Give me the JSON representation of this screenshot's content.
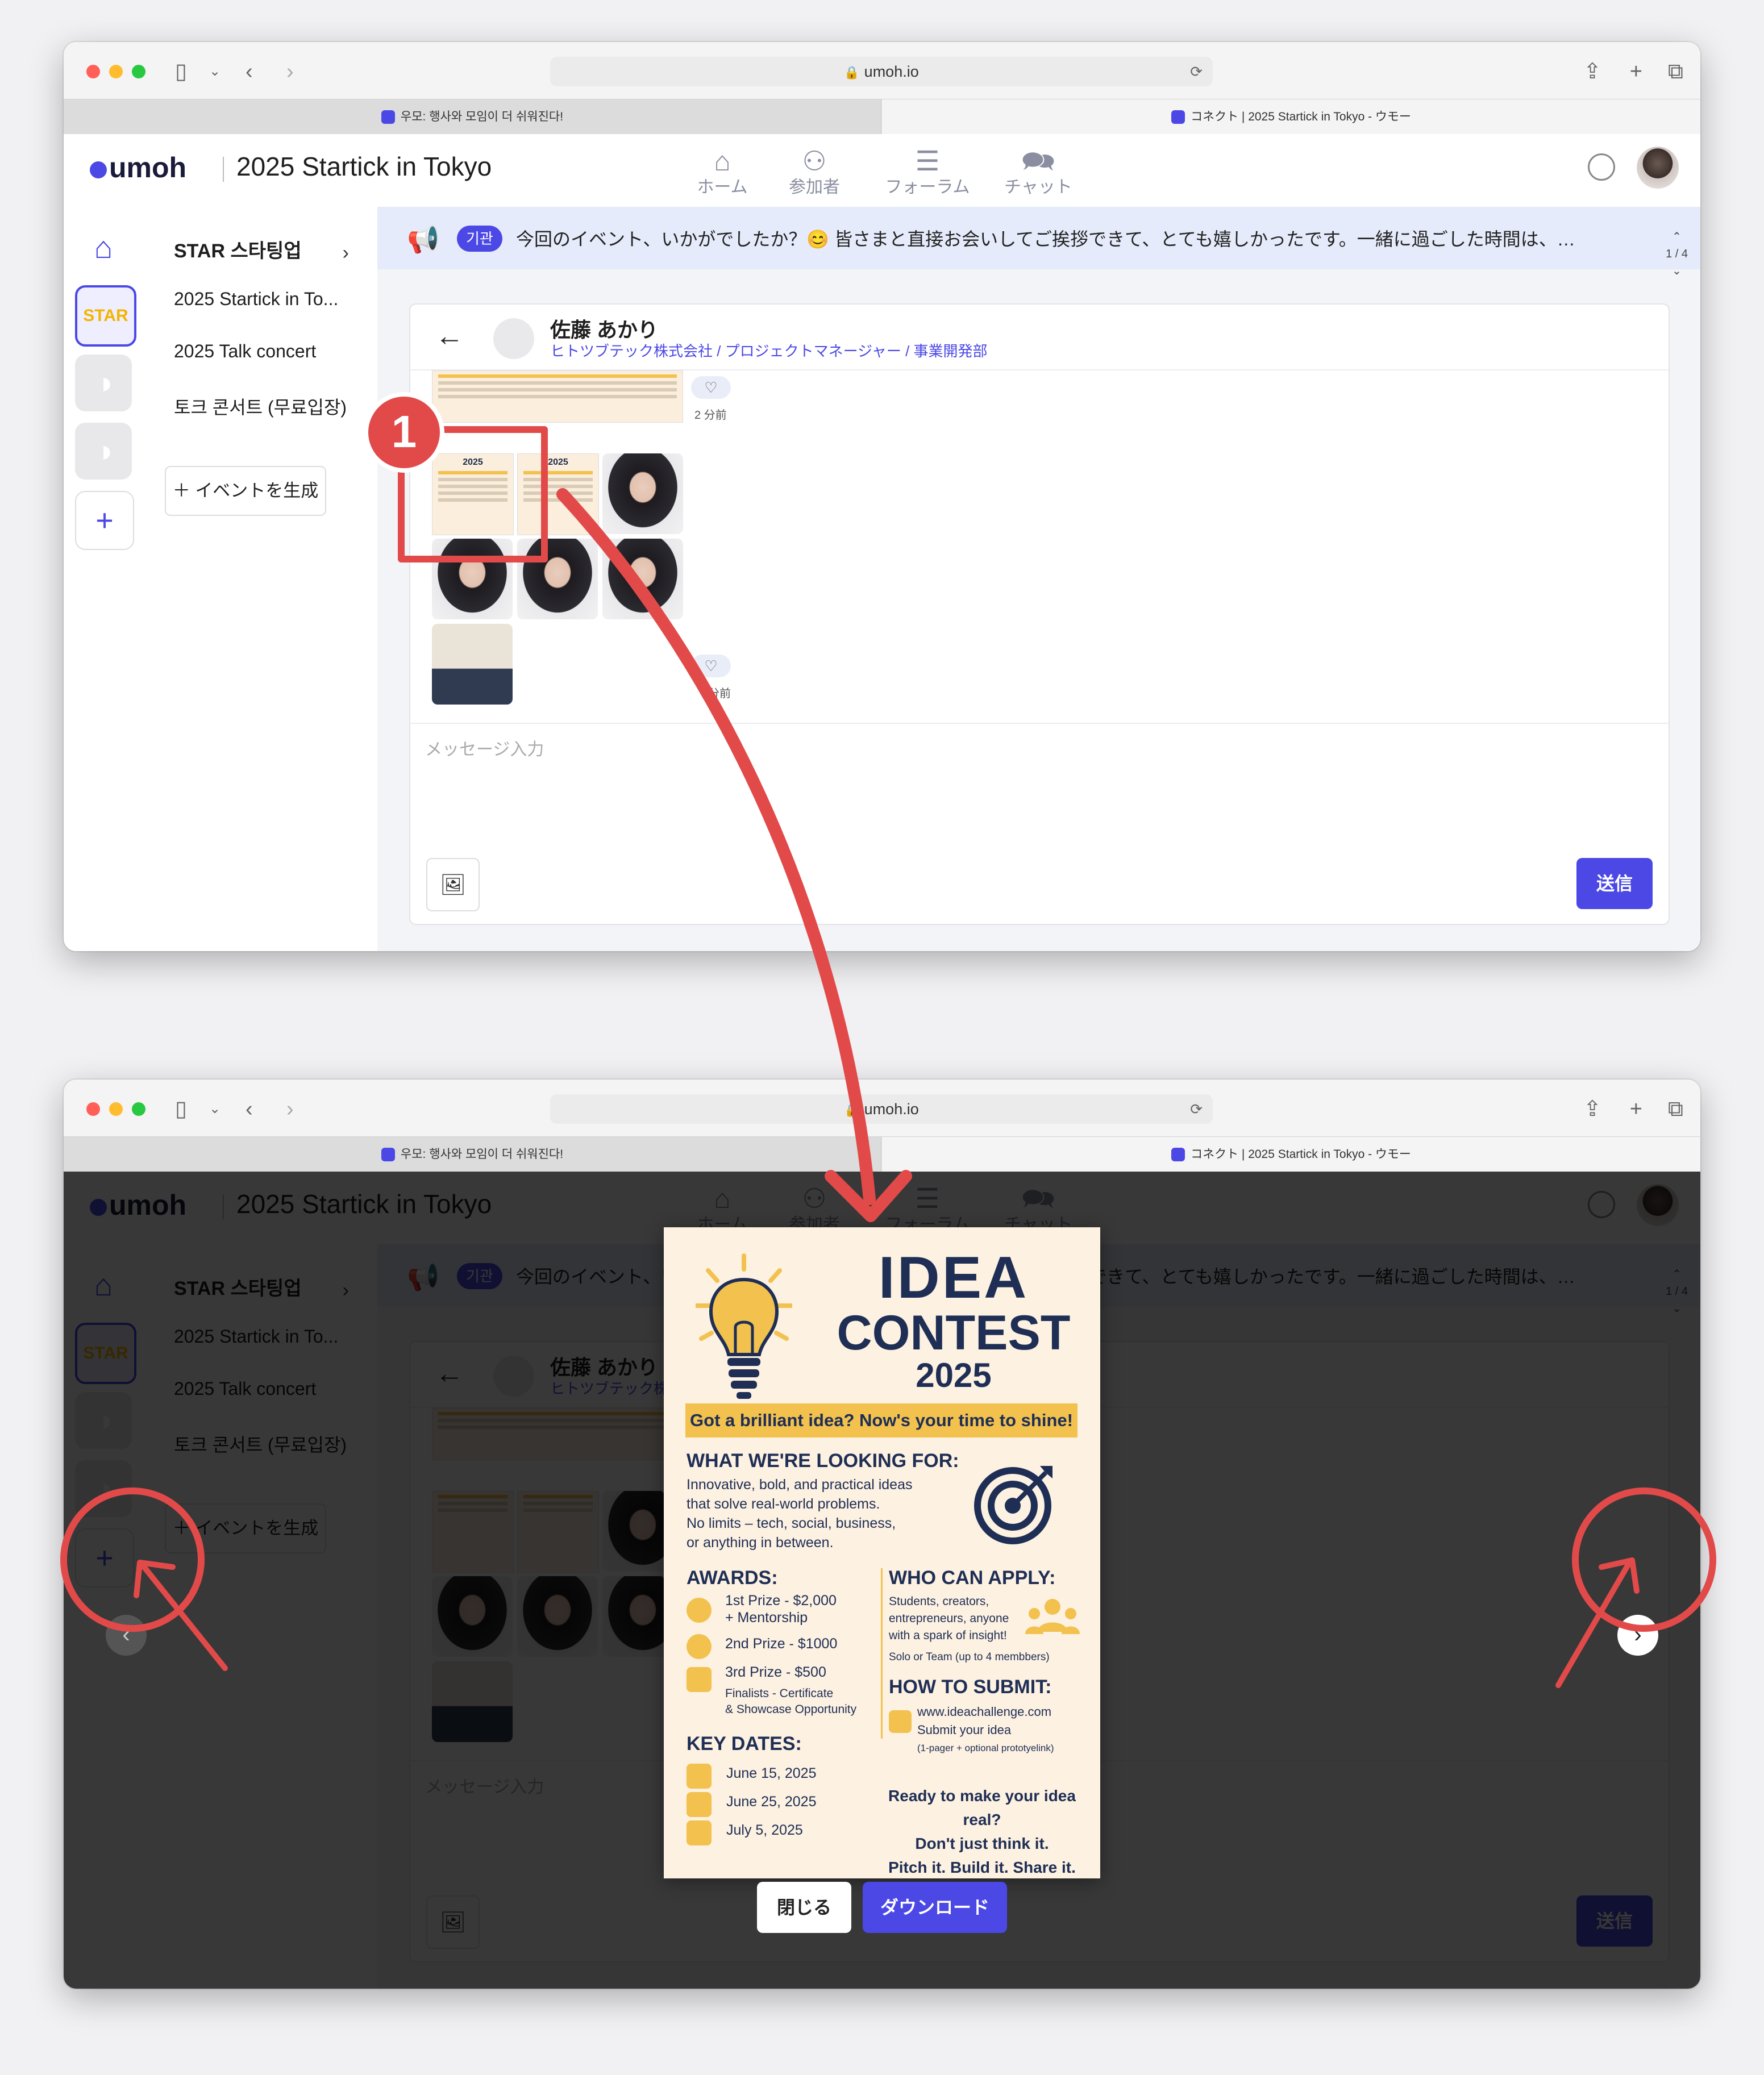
{
  "browser": {
    "url": "umoh.io",
    "tabs": [
      {
        "title": "우모: 행사와 모임이 더 쉬워진다!"
      },
      {
        "title": "コネクト | 2025 Startick in Tokyo - ウモー"
      }
    ]
  },
  "app": {
    "logo": "umoh",
    "event_title": "2025 Startick in Tokyo",
    "nav": [
      {
        "label": "ホーム",
        "icon": "home-icon"
      },
      {
        "label": "参加者",
        "icon": "people-icon"
      },
      {
        "label": "フォーラム",
        "icon": "forum-icon"
      },
      {
        "label": "チャット",
        "icon": "chat-icon"
      }
    ]
  },
  "rail": {
    "star_label": "STAR"
  },
  "sidebar": {
    "org": "STAR 스타팅업",
    "events": [
      "2025 Startick in To...",
      "2025 Talk concert",
      "토크 콘서트 (무료입장)"
    ],
    "create_event": "イベントを生成"
  },
  "notice": {
    "badge": "기관",
    "text": "今回のイベント、いかがでしたか？😊 皆さまと直接お会いしてご挨拶できて、とても嬉しかったです。一緒に過ごした時間は、私たちにとって...",
    "counter": "1 / 4"
  },
  "chat": {
    "partner_name": "佐藤 あかり",
    "partner_org": "ヒトツブテック株式会社 / プロジェクトマネージャー / 事業開発部",
    "time_ago": "2 分前",
    "time_ago_2": "分前",
    "input_placeholder": "メッセージ入力",
    "send_label": "送信"
  },
  "callout": {
    "number": "1"
  },
  "modal": {
    "close_label": "閉じる",
    "download_label": "ダウンロード"
  },
  "poster": {
    "title_line1": "IDEA",
    "title_line2": "CONTEST",
    "year": "2025",
    "tagline": "Got a brilliant idea? Now's your time to shine!",
    "looking_heading": "WHAT WE'RE LOOKING FOR:",
    "looking_text": [
      "Innovative, bold, and practical ideas",
      "that solve real-world problems.",
      "No limits – tech, social, business,",
      "or anything in between."
    ],
    "awards_heading": "AWARDS:",
    "award1a": "1st Prize - $2,000",
    "award1b": "+ Mentorship",
    "award2": "2nd Prize - $1000",
    "award3": "3rd Prize - $500",
    "award4a": "Finalists - Certificate",
    "award4b": "& Showcase Opportunity",
    "apply_heading": "WHO CAN APPLY:",
    "apply_text": [
      "Students, creators,",
      "entrepreneurs, anyone",
      "with a spark of insight!"
    ],
    "apply_note": "Solo or Team (up to 4 membbers)",
    "submit_heading": "HOW TO SUBMIT:",
    "submit_url": "www.ideachallenge.com",
    "submit_text": "Submit your idea",
    "submit_note": "(1-pager + optional prototyelink)",
    "dates_heading": "KEY DATES:",
    "dates": [
      "June 15, 2025",
      "June 25, 2025",
      "July 5, 2025"
    ],
    "cta": [
      "Ready to make your idea real?",
      "Don't just think it.",
      "Pitch it.   Build it.   Share it."
    ]
  },
  "colors": {
    "accent": "#4b48e6",
    "annotation_red": "#e24a4a",
    "poster_yellow": "#f2c14e",
    "poster_navy": "#1e2e55"
  }
}
